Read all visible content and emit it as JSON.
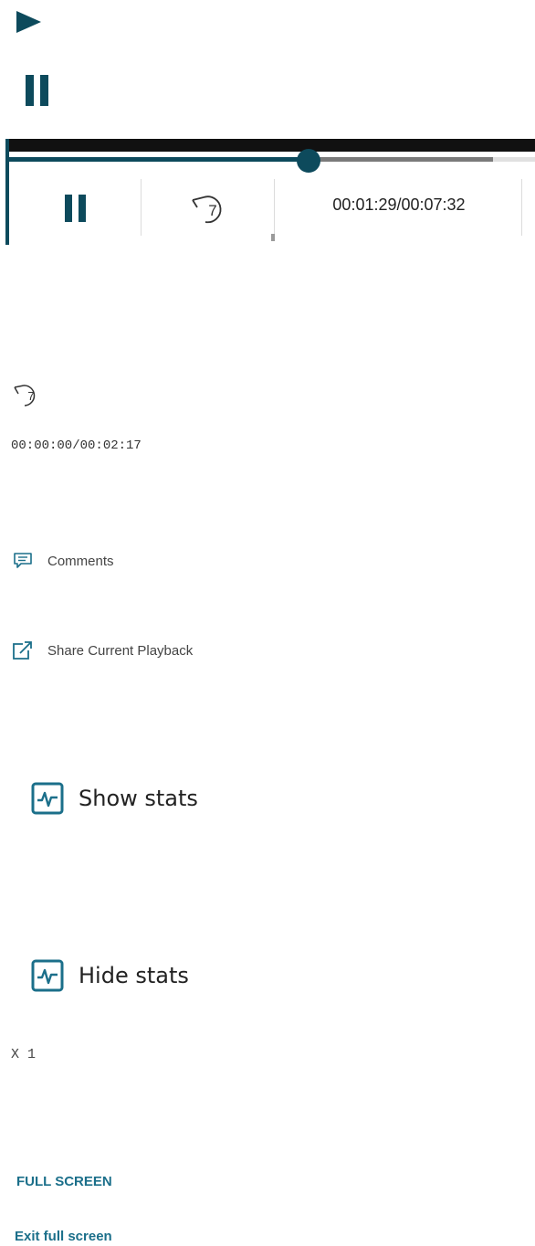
{
  "colors": {
    "accent": "#0d4a5c",
    "link": "#1b6f8a",
    "track_buffer": "#7a7a7a",
    "track_bg": "#e0e0e0"
  },
  "icons": {
    "play": "play-icon",
    "pause": "pause-icon",
    "rewind": "rewind-7-icon",
    "comments": "comment-icon",
    "share": "share-icon",
    "stats": "stats-icon"
  },
  "player_bar": {
    "rewind_seconds": "7",
    "time_display": "00:01:29/00:07:32",
    "progress_played": 0.57,
    "progress_buffered": 0.92
  },
  "secondary": {
    "rewind_seconds": "7",
    "time_display": "00:00:00/00:02:17"
  },
  "links": {
    "comments": "Comments",
    "share": "Share Current Playback"
  },
  "stats": {
    "show": "Show stats",
    "hide": "Hide stats"
  },
  "speed": {
    "label": "X 1"
  },
  "fullscreen": {
    "enter": "FULL SCREEN",
    "exit": "Exit full screen"
  }
}
